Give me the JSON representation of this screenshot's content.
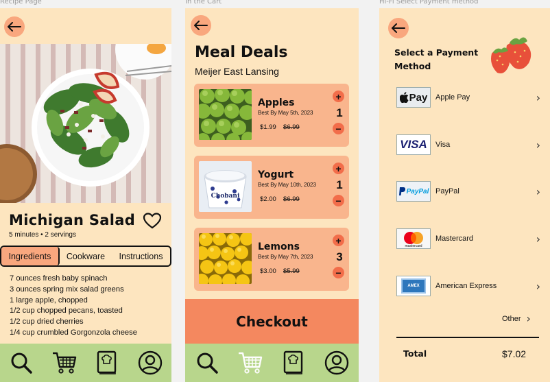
{
  "frames": {
    "recipe": "Recipe Page",
    "cart": "In the Cart",
    "payment": "Hi-Fi Select Payment method"
  },
  "recipe": {
    "title": "Michigan Salad",
    "meta": "5 minutes • 2 servings",
    "tabs": [
      "Ingredients",
      "Cookware",
      "Instructions"
    ],
    "ingredients": [
      "7 ounces fresh baby spinach",
      "3 ounces spring mix salad greens",
      "1 large apple, chopped",
      "1/2 cup  chopped pecans, toasted",
      "1/2 cup dried cherries",
      "1/4 cup crumbled Gorgonzola cheese"
    ]
  },
  "cart": {
    "title": "Meal Deals",
    "store": "Meijer East Lansing",
    "items": [
      {
        "name": "Apples",
        "best_by": "Best By May 5th, 2023",
        "price": "$1.99",
        "old_price": "$6.99",
        "qty": "1"
      },
      {
        "name": "Yogurt",
        "best_by": "Best By May 10th, 2023",
        "price": "$2.00",
        "old_price": "$6.99",
        "qty": "1"
      },
      {
        "name": "Lemons",
        "best_by": "Best By May 7th, 2023",
        "price": "$3.00",
        "old_price": "$5.99",
        "qty": "3"
      }
    ],
    "plus": "+",
    "minus": "−",
    "checkout": "Checkout",
    "yogurt_brand": "Chobani"
  },
  "payment": {
    "title_line1": "Select a Payment",
    "title_line2": "Method",
    "methods": [
      {
        "name": "Apple Pay",
        "logo": "Pay"
      },
      {
        "name": "Visa",
        "logo": "VISA"
      },
      {
        "name": "PayPal",
        "logo": "PayPal"
      },
      {
        "name": "Mastercard",
        "logo": "mastercard"
      },
      {
        "name": "American Express",
        "logo": "AMEX"
      }
    ],
    "chevron": "›",
    "other": "Other",
    "total_label": "Total",
    "total_value": "$7.02"
  },
  "colors": {
    "background": "#fde5bf",
    "accent": "#f9a77e",
    "item_card": "#f9b58d",
    "checkout": "#f4885f",
    "nav": "#b8d68c",
    "qty_button": "#f26d4a"
  },
  "icons": {
    "back": "arrow-left-icon",
    "favorite": "heart-icon",
    "nav": [
      "search-icon",
      "cart-icon",
      "recipe-book-icon",
      "profile-icon"
    ]
  }
}
